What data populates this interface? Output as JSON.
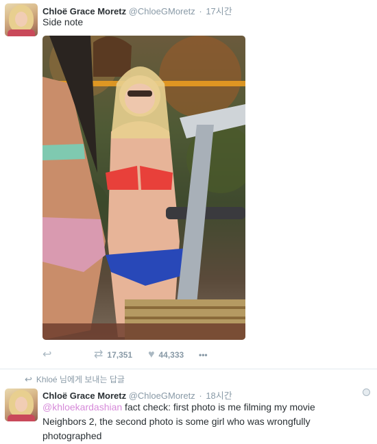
{
  "tweet1": {
    "name": "Chloë Grace Moretz",
    "handle": "@ChloeGMoretz",
    "separator": "·",
    "time": "17시간",
    "text": "Side note",
    "actions": {
      "reply_icon": "reply-icon",
      "retweet_icon": "retweet-icon",
      "retweet_count": "17,351",
      "like_icon": "heart-icon",
      "like_count": "44,333",
      "more_icon": "more-icon",
      "more_label": "•••"
    }
  },
  "reply_context": {
    "icon": "reply-arrow-icon",
    "text": "Khloé 님에게 보내는 답글"
  },
  "tweet2": {
    "name": "Chloë Grace Moretz",
    "handle": "@ChloeGMoretz",
    "separator": "·",
    "time": "18시간",
    "mention": "@khloekardashian",
    "text": " fact check: first photo is me filming my movie Neighbors 2, the second photo is some girl who was wrongfully photographed",
    "globe_icon": "globe-icon"
  },
  "colors": {
    "mention": "#d68ad9",
    "muted": "#8899a6",
    "text": "#292f33"
  }
}
